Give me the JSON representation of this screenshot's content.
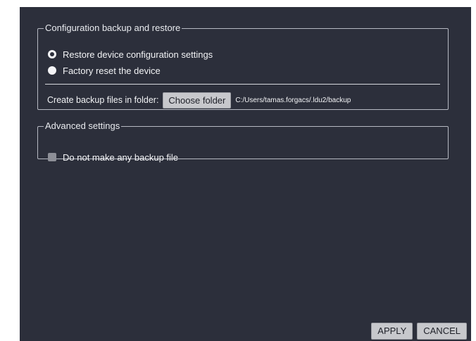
{
  "backup_group": {
    "title": "Configuration backup and restore",
    "options": {
      "restore_label": "Restore device configuration settings",
      "factory_label": "Factory reset the device",
      "selected": "restore"
    },
    "folder": {
      "label": "Create backup files in folder:",
      "button_label": "Choose folder",
      "path": "C:/Users/tamas.forgacs/.ldu2/backup"
    }
  },
  "advanced_group": {
    "title": "Advanced settings",
    "no_backup_label": "Do not make any backup file",
    "no_backup_checked": false
  },
  "footer": {
    "apply_label": "APPLY",
    "cancel_label": "CANCEL"
  },
  "colors": {
    "panel_bg": "#2c2f3b",
    "button_bg": "#c7c8cc",
    "text": "#f2f3f5"
  }
}
